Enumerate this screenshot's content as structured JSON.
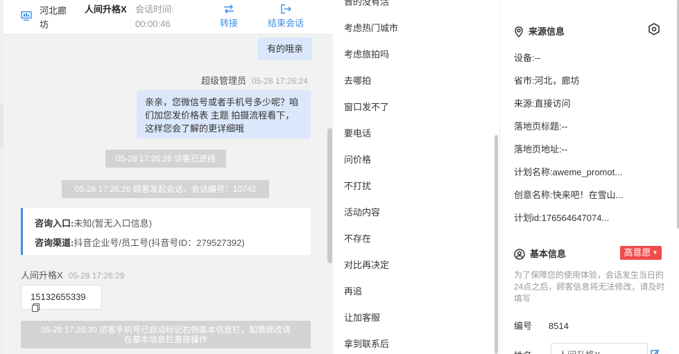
{
  "header": {
    "location": "河北廊坊",
    "visitor_name": "人间升格X",
    "time_label": "会话时间:",
    "time_value": "00:00:46",
    "transfer_label": "转接",
    "end_label": "结束会话"
  },
  "messages": {
    "b1_text": "有的哦亲",
    "m1_sender": "超级管理员",
    "m1_time": "05-28 17:26:24",
    "b2_text": "亲亲，您微信号或者手机号多少呢？咱们加您发价格表 主题 拍摄流程看下，这样您会了解的更详细哦",
    "s1": "05-28 17:26:26 访客已进线",
    "s2": "05-28 17:26:26 顾客发起会话，会话编号：10742",
    "entry_k1": "咨询入口:",
    "entry_v1": "未知(暂无入口信息)",
    "entry_k2": "咨询渠道:",
    "entry_v2": "抖音企业号/员工号(抖音号ID：279527392)",
    "m2_sender": "人间升格X",
    "m2_time": "05-28 17:26:29",
    "phone": "15132655339",
    "s3": "05-28 17:26:30 访客手机号已自动标记右侧基本信息栏，如需修改请\n在基本信息栏直接操作"
  },
  "quick_replies": [
    "晋的没有活",
    "考虑热门城市",
    "考虑旅拍吗",
    "去哪拍",
    "窗口发不了",
    "要电话",
    "问价格",
    "不打扰",
    "活动内容",
    "不存在",
    "对比再决定",
    "再追",
    "让加客服",
    "拿到联系后"
  ],
  "source_info": {
    "title": "来源信息",
    "device_k": "设备:",
    "device_v": "--",
    "province_k": "省市:",
    "province_v": "河北，廊坊",
    "source_k": "来源:",
    "source_v": "直接访问",
    "landing_title_k": "落地页标题:",
    "landing_title_v": "--",
    "landing_url_k": "落地页地址:",
    "landing_url_v": "--",
    "plan_name_k": "计划名称:",
    "plan_name_v": "aweme_promot...",
    "creative_k": "创意名称:",
    "creative_v": "快来吧！在雪山...",
    "plan_id_k": "计划id:",
    "plan_id_v": "176564647074..."
  },
  "basic_info": {
    "title": "基本信息",
    "intent_badge": "高意愿",
    "notice": "为了保障您的使用体验，会话发生当日的24点之后，顾客信息将无法修改，请及时填写",
    "code_k": "编号",
    "code_v": "8514",
    "name_k": "姓名",
    "name_v": "人间升格X"
  },
  "colors": {
    "accent": "#3a8ee6",
    "bubble_out": "#dbe8fb",
    "system_msg": "#d3d3d3",
    "badge": "#f04b4b"
  }
}
